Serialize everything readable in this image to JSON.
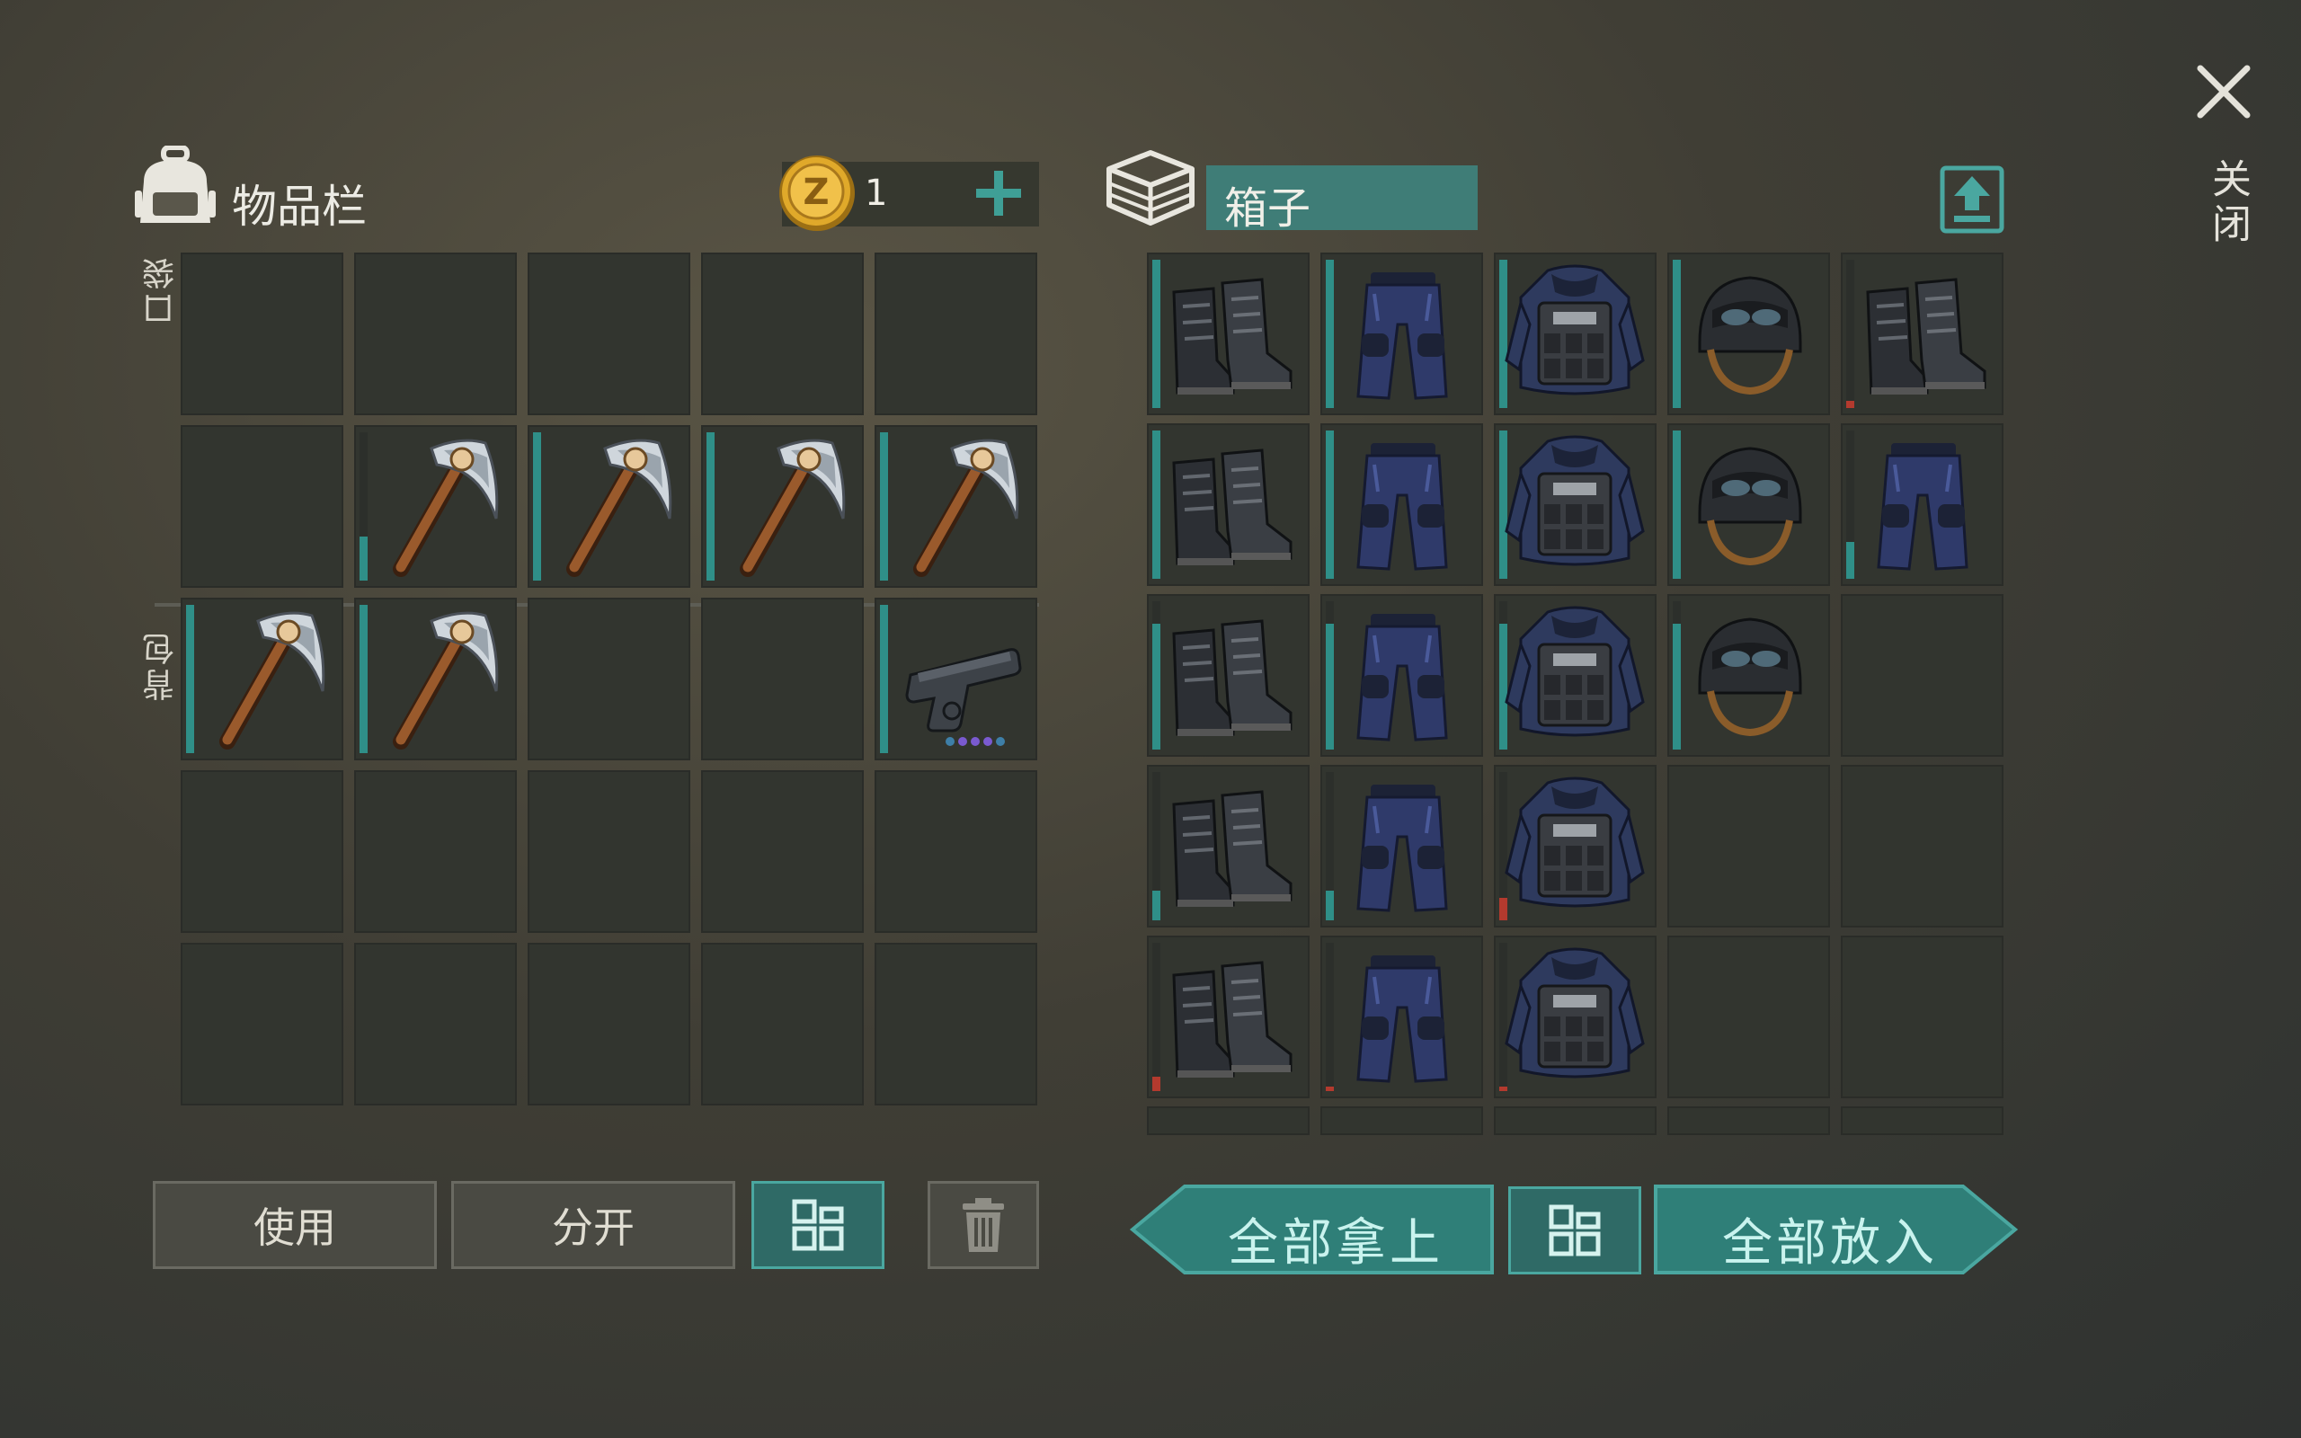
{
  "inventory": {
    "title": "物品栏",
    "pocket_label": "口袋",
    "backpack_label": "背包",
    "coins": "1",
    "slots": [
      {
        "item": "",
        "dur": 0,
        "dur_color": ""
      },
      {
        "item": "",
        "dur": 0,
        "dur_color": ""
      },
      {
        "item": "",
        "dur": 0,
        "dur_color": ""
      },
      {
        "item": "",
        "dur": 0,
        "dur_color": ""
      },
      {
        "item": "",
        "dur": 0,
        "dur_color": ""
      },
      {
        "item": "",
        "dur": 0,
        "dur_color": ""
      },
      {
        "item": "pickaxe-icon",
        "dur": 0.3,
        "dur_color": "#2f8f88"
      },
      {
        "item": "pickaxe-icon",
        "dur": 1,
        "dur_color": "#2f8f88"
      },
      {
        "item": "pickaxe-icon",
        "dur": 1,
        "dur_color": "#2f8f88"
      },
      {
        "item": "pickaxe-icon",
        "dur": 1,
        "dur_color": "#2f8f88"
      },
      {
        "item": "pickaxe-icon",
        "dur": 1,
        "dur_color": "#2f8f88"
      },
      {
        "item": "pickaxe-icon",
        "dur": 1,
        "dur_color": "#2f8f88"
      },
      {
        "item": "",
        "dur": 0,
        "dur_color": ""
      },
      {
        "item": "",
        "dur": 0,
        "dur_color": ""
      },
      {
        "item": "pistol-icon",
        "dur": 1,
        "dur_color": "#2f8f88"
      },
      {
        "item": "",
        "dur": 0,
        "dur_color": ""
      },
      {
        "item": "",
        "dur": 0,
        "dur_color": ""
      },
      {
        "item": "",
        "dur": 0,
        "dur_color": ""
      },
      {
        "item": "",
        "dur": 0,
        "dur_color": ""
      },
      {
        "item": "",
        "dur": 0,
        "dur_color": ""
      },
      {
        "item": "",
        "dur": 0,
        "dur_color": ""
      },
      {
        "item": "",
        "dur": 0,
        "dur_color": ""
      },
      {
        "item": "",
        "dur": 0,
        "dur_color": ""
      },
      {
        "item": "",
        "dur": 0,
        "dur_color": ""
      },
      {
        "item": "",
        "dur": 0,
        "dur_color": ""
      }
    ],
    "buttons": {
      "use": "使用",
      "split": "分开"
    }
  },
  "box": {
    "title": "箱子",
    "slots": [
      {
        "item": "boots-icon",
        "dur": 1,
        "dur_color": "#2f8f88"
      },
      {
        "item": "pants-icon",
        "dur": 1,
        "dur_color": "#2f8f88"
      },
      {
        "item": "vest-icon",
        "dur": 1,
        "dur_color": "#2f8f88"
      },
      {
        "item": "helmet-icon",
        "dur": 1,
        "dur_color": "#2f8f88"
      },
      {
        "item": "boots-icon",
        "dur": 0.05,
        "dur_color": "#b33a2e"
      },
      {
        "item": "boots-icon",
        "dur": 1,
        "dur_color": "#2f8f88"
      },
      {
        "item": "pants-icon",
        "dur": 1,
        "dur_color": "#2f8f88"
      },
      {
        "item": "vest-icon",
        "dur": 1,
        "dur_color": "#2f8f88"
      },
      {
        "item": "helmet-icon",
        "dur": 1,
        "dur_color": "#2f8f88"
      },
      {
        "item": "pants-icon",
        "dur": 0.25,
        "dur_color": "#2f8f88"
      },
      {
        "item": "boots-icon",
        "dur": 0.85,
        "dur_color": "#2f8f88"
      },
      {
        "item": "pants-icon",
        "dur": 0.85,
        "dur_color": "#2f8f88"
      },
      {
        "item": "vest-icon",
        "dur": 0.85,
        "dur_color": "#2f8f88"
      },
      {
        "item": "helmet-icon",
        "dur": 0.85,
        "dur_color": "#2f8f88"
      },
      {
        "item": "",
        "dur": 0,
        "dur_color": ""
      },
      {
        "item": "boots-icon",
        "dur": 0.2,
        "dur_color": "#2f8f88"
      },
      {
        "item": "pants-icon",
        "dur": 0.2,
        "dur_color": "#2f8f88"
      },
      {
        "item": "vest-icon",
        "dur": 0.15,
        "dur_color": "#b33a2e"
      },
      {
        "item": "",
        "dur": 0,
        "dur_color": ""
      },
      {
        "item": "",
        "dur": 0,
        "dur_color": ""
      },
      {
        "item": "boots-icon",
        "dur": 0.1,
        "dur_color": "#b33a2e"
      },
      {
        "item": "pants-icon",
        "dur": 0.03,
        "dur_color": "#b33a2e"
      },
      {
        "item": "vest-icon",
        "dur": 0.03,
        "dur_color": "#b33a2e"
      },
      {
        "item": "",
        "dur": 0,
        "dur_color": ""
      },
      {
        "item": "",
        "dur": 0,
        "dur_color": ""
      }
    ],
    "buttons": {
      "take_all": "全部拿上",
      "put_all": "全部放入"
    }
  },
  "close_label": "关闭",
  "colors": {
    "teal": "#2f7f78",
    "teal_light": "#4aa7a0",
    "durability_ok": "#2f8f88",
    "durability_low": "#b33a2e"
  }
}
